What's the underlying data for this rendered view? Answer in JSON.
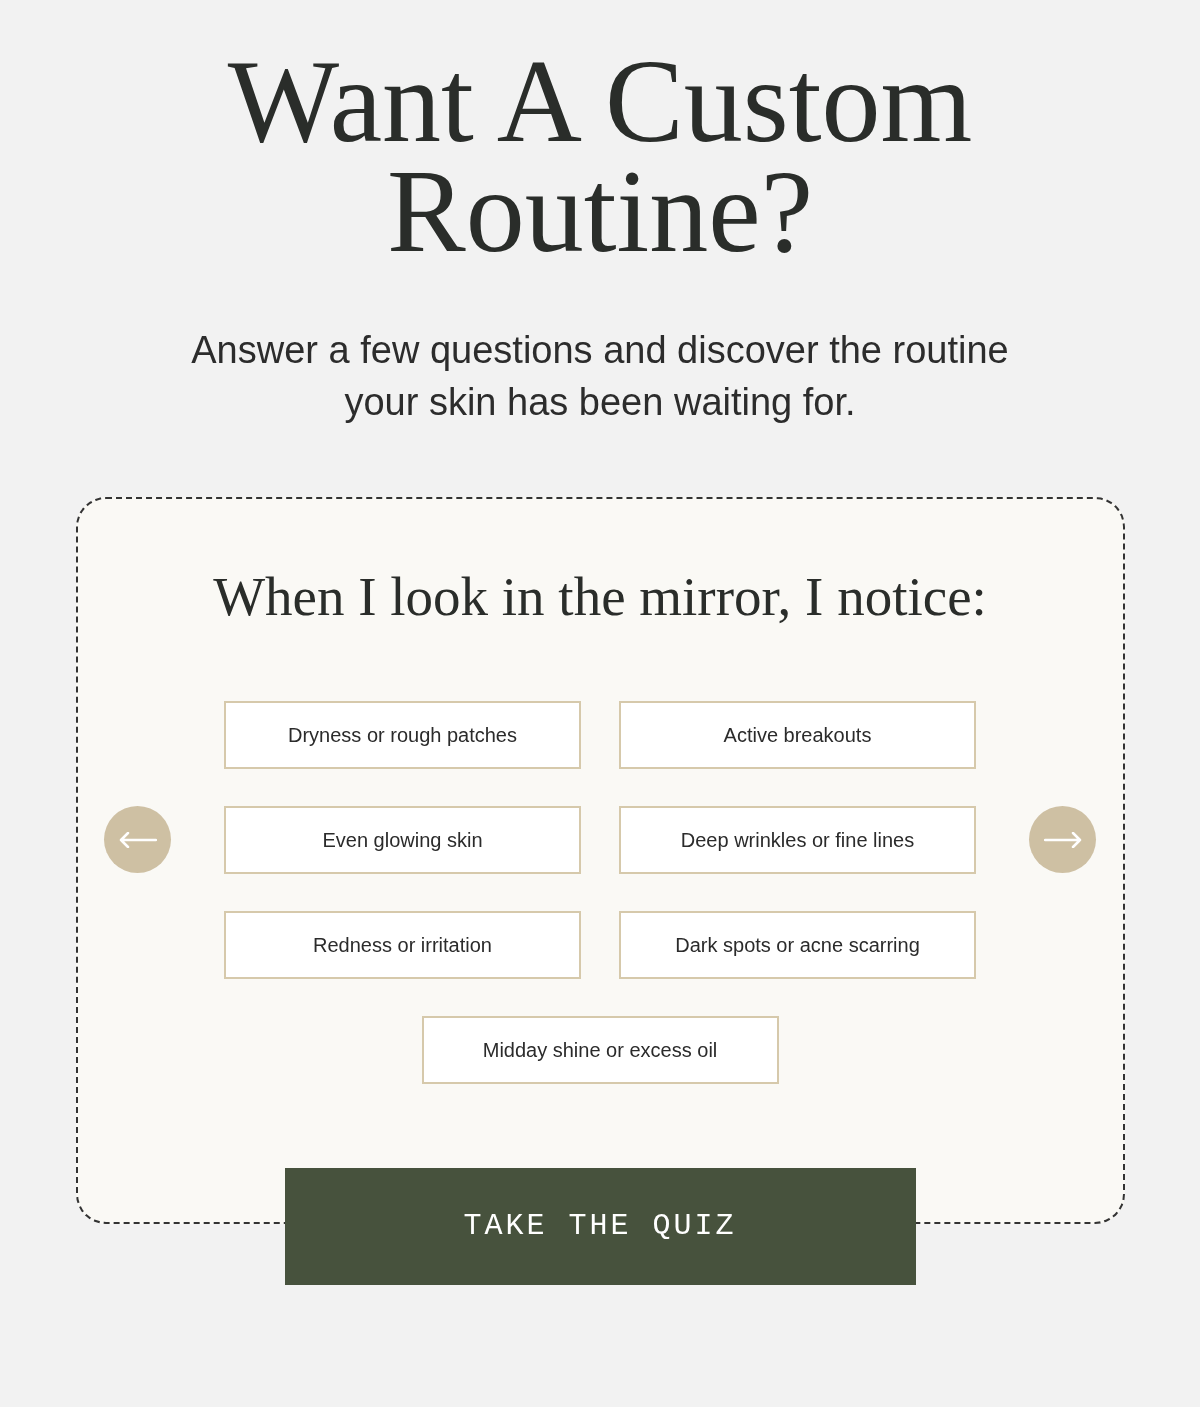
{
  "heading": {
    "title": "Want A Custom Routine?",
    "subtitle": "Answer a few questions and discover the routine your skin has been waiting for."
  },
  "quiz": {
    "question": "When I look in the mirror, I notice:",
    "options": [
      {
        "label": "Dryness or rough patches",
        "selected": false
      },
      {
        "label": "Active breakouts",
        "selected": false
      },
      {
        "label": "Even glowing skin",
        "selected": false
      },
      {
        "label": "Deep wrinkles or fine lines",
        "selected": false
      },
      {
        "label": "Redness or irritation",
        "selected": false
      },
      {
        "label": "Dark spots or acne scarring",
        "selected": false
      },
      {
        "label": "Midday shine or excess oil",
        "selected": false
      }
    ],
    "cta": "TAKE THE QUIZ"
  }
}
